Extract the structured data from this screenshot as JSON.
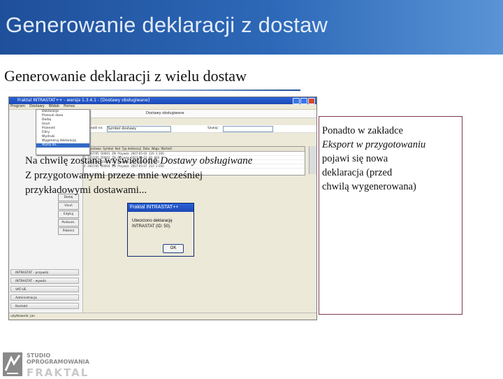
{
  "slide": {
    "title": "Generowanie deklaracji z dostaw",
    "subtitle": "Generowanie deklaracji z wielu dostaw"
  },
  "window": {
    "title": "Fraktal INTRASTAT++ - wersja 1.3.4.1 - [Dostawy obsługiwane]",
    "menu": [
      "Program",
      "Dostawy",
      "Widok",
      "Pomoc"
    ],
    "dropdown": [
      "Deklaracje",
      "Przesuń dane",
      "Dodaj",
      "Usuń",
      "Przenieś",
      "Filtry",
      "Wydruki",
      "Wygeneruj deklarację",
      "Wyślij do..."
    ],
    "tab_label": "Dostawy obsługiwane",
    "filter_label": "Przejdź na:",
    "filter_value": "Symbol dostawy",
    "search_label": "Szukaj:",
    "grid_headers": [
      "Lp",
      "Dostawa",
      "Symbol",
      "Kod",
      "Typ deklaracji",
      "Data",
      "Waga",
      "Wartość"
    ],
    "grid_rows": [
      [
        "1",
        "2007/05",
        "D0001",
        "ZN",
        "Przywóz",
        "2007-05-02",
        "120",
        "1 200"
      ],
      [
        "2",
        "2007/05",
        "D0002",
        "ZN",
        "Przywóz",
        "2007-05-03",
        "80",
        "840"
      ],
      [
        "3",
        "2007/05",
        "D0003",
        "ZN",
        "Przywóz",
        "2007-05-04",
        "45",
        "410"
      ],
      [
        "4",
        "2007/05",
        "D0004",
        "ZN",
        "Przywóz",
        "2007-05-07",
        "210",
        "2 050"
      ]
    ],
    "side_buttons": [
      "Dodaj",
      "Usuń",
      "Edytuj",
      "Podsum.",
      "Pobierz"
    ],
    "nav_items": [
      "INTRASTAT - przywóz",
      "INTRASTAT - wywóz",
      "VAT-UE",
      "Administracja",
      "Kontakt"
    ],
    "status_text": "użytkownik: jan"
  },
  "modal": {
    "title": "Fraktal INTRASTAT++",
    "message": "Utworzono deklarację INTRASTAT (ID: 50).",
    "ok_label": "OK"
  },
  "overlay": {
    "line1_prefix": "Na chwilę zostaną wyświetlone ",
    "line1_italic": "Dostawy obsługiwane",
    "line2": "Z przygotowanymi przeze mnie wcześniej",
    "line3": "przykładowymi dostawami..."
  },
  "note": {
    "line1": "Ponadto w zakładce",
    "line2_italic": "Eksport w przygotowaniu",
    "line3": "pojawi się nowa",
    "line4": "deklaracja (przed",
    "line5": "chwilą wygenerowana)"
  },
  "logo": {
    "line1": "STUDIO",
    "line2": "OPROGRAMOWANIA",
    "big": "FRAKTAL"
  },
  "colors": {
    "header_blue": "#1f4f9a",
    "note_border": "#7a3850"
  }
}
